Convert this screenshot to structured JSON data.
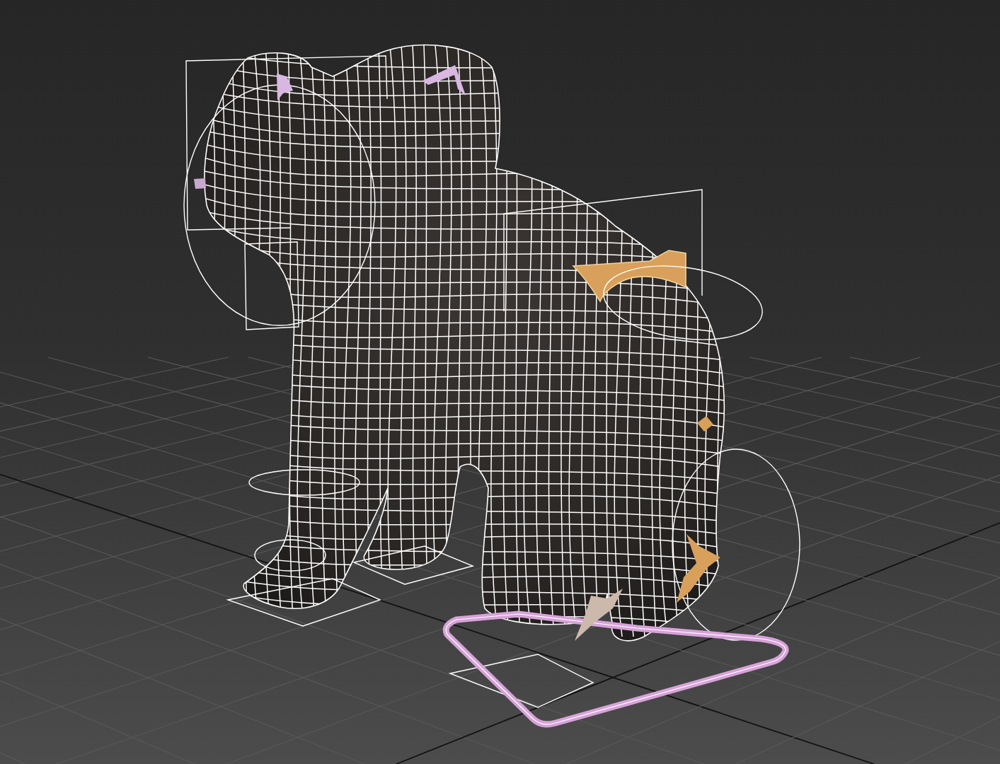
{
  "viewport": {
    "grid": true
  },
  "model": {
    "kind": "elephant",
    "wireframe": true
  },
  "rig_controls": [
    {
      "kind": "frame",
      "color": "#ffffff"
    },
    {
      "kind": "frame",
      "color": "#ffffff"
    },
    {
      "kind": "ring",
      "color": "#ffffff"
    },
    {
      "kind": "marker",
      "color": "#d8b8e0"
    },
    {
      "kind": "marker",
      "color": "#d8b8e0"
    },
    {
      "kind": "marker",
      "color": "#c9a8d0"
    },
    {
      "kind": "frame",
      "color": "#ffffff"
    },
    {
      "kind": "box",
      "color": "#d9a05b"
    },
    {
      "kind": "ring",
      "color": "#ffffff"
    },
    {
      "kind": "ring",
      "color": "#ffffff"
    },
    {
      "kind": "ring",
      "color": "#ffffff"
    },
    {
      "kind": "ring",
      "color": "#ffffff"
    },
    {
      "kind": "plate",
      "color": "#ffffff"
    },
    {
      "kind": "plate",
      "color": "#ffffff"
    },
    {
      "kind": "plate",
      "color": "#ffffff"
    },
    {
      "kind": "loop",
      "color": "#d7a2d9"
    },
    {
      "kind": "marker",
      "color": "#d9a05b"
    },
    {
      "kind": "marker",
      "color": "#cdb9ab"
    },
    {
      "kind": "marker",
      "color": "#d9a05b"
    }
  ]
}
